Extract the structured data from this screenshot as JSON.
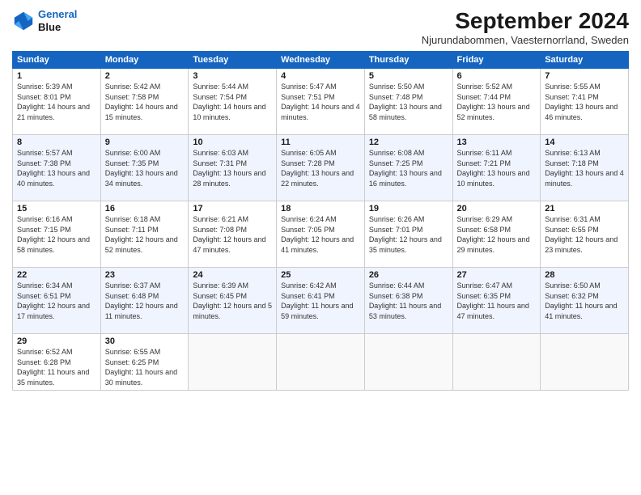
{
  "header": {
    "logo_line1": "General",
    "logo_line2": "Blue",
    "title": "September 2024",
    "subtitle": "Njurundabommen, Vaesternorrland, Sweden"
  },
  "days_of_week": [
    "Sunday",
    "Monday",
    "Tuesday",
    "Wednesday",
    "Thursday",
    "Friday",
    "Saturday"
  ],
  "weeks": [
    [
      {
        "day": "1",
        "info": "Sunrise: 5:39 AM\nSunset: 8:01 PM\nDaylight: 14 hours and 21 minutes."
      },
      {
        "day": "2",
        "info": "Sunrise: 5:42 AM\nSunset: 7:58 PM\nDaylight: 14 hours and 15 minutes."
      },
      {
        "day": "3",
        "info": "Sunrise: 5:44 AM\nSunset: 7:54 PM\nDaylight: 14 hours and 10 minutes."
      },
      {
        "day": "4",
        "info": "Sunrise: 5:47 AM\nSunset: 7:51 PM\nDaylight: 14 hours and 4 minutes."
      },
      {
        "day": "5",
        "info": "Sunrise: 5:50 AM\nSunset: 7:48 PM\nDaylight: 13 hours and 58 minutes."
      },
      {
        "day": "6",
        "info": "Sunrise: 5:52 AM\nSunset: 7:44 PM\nDaylight: 13 hours and 52 minutes."
      },
      {
        "day": "7",
        "info": "Sunrise: 5:55 AM\nSunset: 7:41 PM\nDaylight: 13 hours and 46 minutes."
      }
    ],
    [
      {
        "day": "8",
        "info": "Sunrise: 5:57 AM\nSunset: 7:38 PM\nDaylight: 13 hours and 40 minutes."
      },
      {
        "day": "9",
        "info": "Sunrise: 6:00 AM\nSunset: 7:35 PM\nDaylight: 13 hours and 34 minutes."
      },
      {
        "day": "10",
        "info": "Sunrise: 6:03 AM\nSunset: 7:31 PM\nDaylight: 13 hours and 28 minutes."
      },
      {
        "day": "11",
        "info": "Sunrise: 6:05 AM\nSunset: 7:28 PM\nDaylight: 13 hours and 22 minutes."
      },
      {
        "day": "12",
        "info": "Sunrise: 6:08 AM\nSunset: 7:25 PM\nDaylight: 13 hours and 16 minutes."
      },
      {
        "day": "13",
        "info": "Sunrise: 6:11 AM\nSunset: 7:21 PM\nDaylight: 13 hours and 10 minutes."
      },
      {
        "day": "14",
        "info": "Sunrise: 6:13 AM\nSunset: 7:18 PM\nDaylight: 13 hours and 4 minutes."
      }
    ],
    [
      {
        "day": "15",
        "info": "Sunrise: 6:16 AM\nSunset: 7:15 PM\nDaylight: 12 hours and 58 minutes."
      },
      {
        "day": "16",
        "info": "Sunrise: 6:18 AM\nSunset: 7:11 PM\nDaylight: 12 hours and 52 minutes."
      },
      {
        "day": "17",
        "info": "Sunrise: 6:21 AM\nSunset: 7:08 PM\nDaylight: 12 hours and 47 minutes."
      },
      {
        "day": "18",
        "info": "Sunrise: 6:24 AM\nSunset: 7:05 PM\nDaylight: 12 hours and 41 minutes."
      },
      {
        "day": "19",
        "info": "Sunrise: 6:26 AM\nSunset: 7:01 PM\nDaylight: 12 hours and 35 minutes."
      },
      {
        "day": "20",
        "info": "Sunrise: 6:29 AM\nSunset: 6:58 PM\nDaylight: 12 hours and 29 minutes."
      },
      {
        "day": "21",
        "info": "Sunrise: 6:31 AM\nSunset: 6:55 PM\nDaylight: 12 hours and 23 minutes."
      }
    ],
    [
      {
        "day": "22",
        "info": "Sunrise: 6:34 AM\nSunset: 6:51 PM\nDaylight: 12 hours and 17 minutes."
      },
      {
        "day": "23",
        "info": "Sunrise: 6:37 AM\nSunset: 6:48 PM\nDaylight: 12 hours and 11 minutes."
      },
      {
        "day": "24",
        "info": "Sunrise: 6:39 AM\nSunset: 6:45 PM\nDaylight: 12 hours and 5 minutes."
      },
      {
        "day": "25",
        "info": "Sunrise: 6:42 AM\nSunset: 6:41 PM\nDaylight: 11 hours and 59 minutes."
      },
      {
        "day": "26",
        "info": "Sunrise: 6:44 AM\nSunset: 6:38 PM\nDaylight: 11 hours and 53 minutes."
      },
      {
        "day": "27",
        "info": "Sunrise: 6:47 AM\nSunset: 6:35 PM\nDaylight: 11 hours and 47 minutes."
      },
      {
        "day": "28",
        "info": "Sunrise: 6:50 AM\nSunset: 6:32 PM\nDaylight: 11 hours and 41 minutes."
      }
    ],
    [
      {
        "day": "29",
        "info": "Sunrise: 6:52 AM\nSunset: 6:28 PM\nDaylight: 11 hours and 35 minutes."
      },
      {
        "day": "30",
        "info": "Sunrise: 6:55 AM\nSunset: 6:25 PM\nDaylight: 11 hours and 30 minutes."
      },
      {
        "day": "",
        "info": ""
      },
      {
        "day": "",
        "info": ""
      },
      {
        "day": "",
        "info": ""
      },
      {
        "day": "",
        "info": ""
      },
      {
        "day": "",
        "info": ""
      }
    ]
  ]
}
